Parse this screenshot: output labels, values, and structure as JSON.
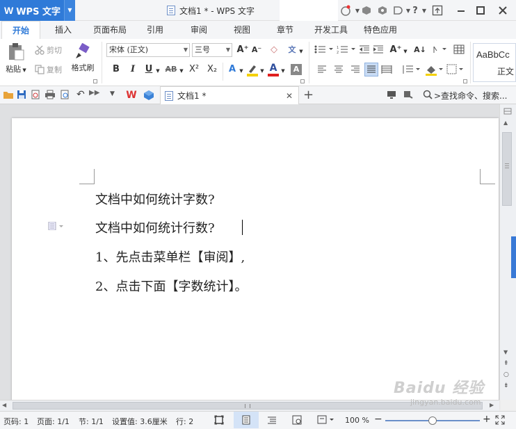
{
  "app": {
    "logo": "W",
    "name": "WPS 文字",
    "doc_title": "文档1 * - WPS 文字"
  },
  "colors": {
    "accent": "#2f7ad8",
    "page": "#ffffff",
    "canvas": "#dfe0e2"
  },
  "ribbon_tabs": [
    "开始",
    "插入",
    "页面布局",
    "引用",
    "审阅",
    "视图",
    "章节",
    "开发工具",
    "特色应用"
  ],
  "ribbon": {
    "paste": "粘贴",
    "cut": "剪切",
    "copy": "复制",
    "format_painter": "格式刷",
    "font_name": "宋体 (正文)",
    "font_size": "三号",
    "style_preview": "AaBbCc",
    "style_name": "正文",
    "bold": "B",
    "italic": "I",
    "underline": "U",
    "strike": "AB",
    "superscript": "X²",
    "subscript": "X₂",
    "grow_font": "A⁺",
    "shrink_font": "A⁻"
  },
  "quick_toolbar": {
    "doc_tab_label": "文档1 *",
    "search_placeholder": ">查找命令、搜索..."
  },
  "document": {
    "lines": [
      "文档中如何统计字数?",
      "文档中如何统计行数?",
      "1、先点击菜单栏【审阅】,",
      "2、点击下面【字数统计】。"
    ]
  },
  "status": {
    "page_code": "页码: 1",
    "pages": "页面: 1/1",
    "section": "节: 1/1",
    "setting": "设置值: 3.6厘米",
    "row": "行: 2",
    "zoom": "100 %",
    "zoom_level": 0.5
  },
  "watermark": {
    "brand": "Baidu 经验",
    "url": "jingyan.baidu.com"
  }
}
